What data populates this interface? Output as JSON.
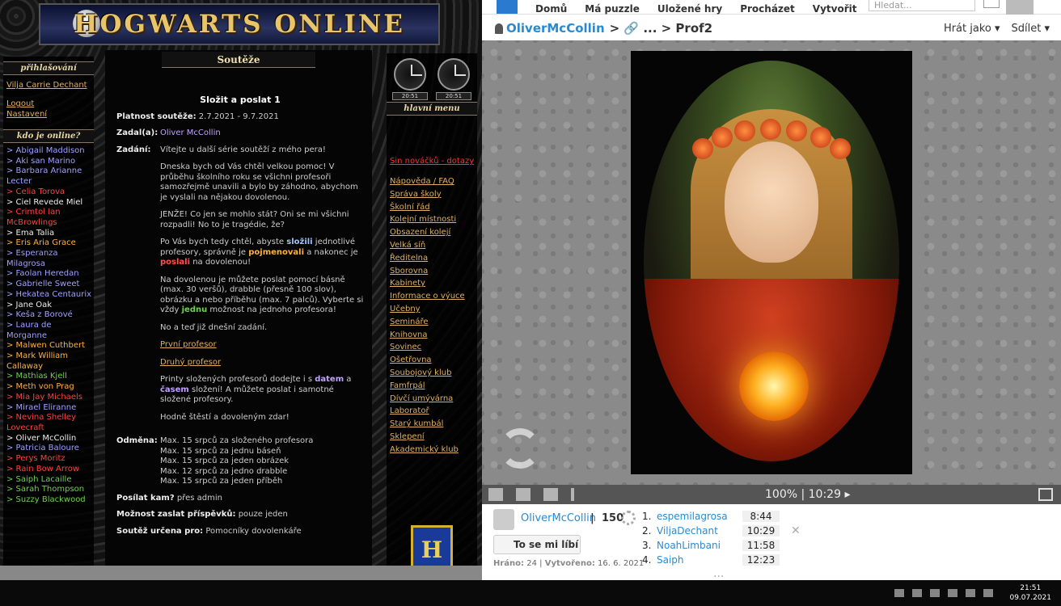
{
  "left": {
    "site_title": "HOGWARTS ONLINE",
    "login_header": "přihlašování",
    "user_link": "Vilja Carrie Dechant",
    "logout": "Logout",
    "settings": "Nastavení",
    "online_header": "kdo je online?",
    "online": [
      {
        "name": "> Abigail Maddison",
        "color": "#a0a0ff"
      },
      {
        "name": "> Aki san Marino",
        "color": "#a0a0ff"
      },
      {
        "name": "> Barbara Arianne Lecter",
        "color": "#a0a0ff"
      },
      {
        "name": "> Celia Torova",
        "color": "#ff4040"
      },
      {
        "name": "> Ciel Revede Miel",
        "color": "#eeeeee"
      },
      {
        "name": "> Crimtol Ian McBrowlings",
        "color": "#ff4040"
      },
      {
        "name": "> Ema Talia",
        "color": "#eeeeee"
      },
      {
        "name": "> Eris Aria Grace",
        "color": "#ffb040"
      },
      {
        "name": "> Esperanza Milagrosa",
        "color": "#a0a0ff"
      },
      {
        "name": "> Faolan Heredan",
        "color": "#a0a0ff"
      },
      {
        "name": "> Gabrielle Sweet",
        "color": "#a0a0ff"
      },
      {
        "name": "> Hekatea Centaurix",
        "color": "#a0a0ff"
      },
      {
        "name": "> Jane Oak",
        "color": "#eeeeee"
      },
      {
        "name": "> Keša z Borové",
        "color": "#a0a0ff"
      },
      {
        "name": "> Laura de Morganne",
        "color": "#a0a0ff"
      },
      {
        "name": "> Malwen Cuthbert",
        "color": "#ffb040"
      },
      {
        "name": "> Mark William Callaway",
        "color": "#ffb040"
      },
      {
        "name": "> Mathias Kjell",
        "color": "#70d050"
      },
      {
        "name": "> Meth von Prag",
        "color": "#ffb040"
      },
      {
        "name": "> Mia Jay Michaels",
        "color": "#ff4040"
      },
      {
        "name": "> Mirael Eliranne",
        "color": "#a0a0ff"
      },
      {
        "name": "> Nevina Shelley Lovecraft",
        "color": "#ff4040"
      },
      {
        "name": "> Oliver McCollin",
        "color": "#eeeeee"
      },
      {
        "name": "> Patricia Baloure",
        "color": "#a0a0ff"
      },
      {
        "name": "> Perys Moritz",
        "color": "#ff4040"
      },
      {
        "name": "> Rain Bow Arrow",
        "color": "#ff4040"
      },
      {
        "name": "> Saiph Lacaille",
        "color": "#70d050"
      },
      {
        "name": "> Sarah Thompson",
        "color": "#70d050"
      },
      {
        "name": "> Suzzy Blackwood",
        "color": "#70d050"
      }
    ],
    "content_header": "Soutěže",
    "contest_title": "Složit a poslat 1",
    "validity_label": "Platnost soutěže:",
    "validity": "2.7.2021 - 9.7.2021",
    "author_label": "Zadal(a):",
    "author": "Oliver McCollin",
    "task_label": "Zadání:",
    "p1": "Vítejte u další série soutěží z mého pera!",
    "p2": "Dneska bych od Vás chtěl velkou pomoc! V průběhu školního roku se všichni profesoři samozřejmě unavili a bylo by záhodno, abychom je vyslali na nějakou dovolenou.",
    "p3": "JENŽE! Co jen se mohlo stát? Oni se mi všichni rozpadli! No to je tragédie, že?",
    "p4a": "Po Vás bych tedy chtěl, abyste ",
    "p4b": "složili",
    "p4c": " jednotlivé profesory, správně je ",
    "p4d": "pojmenovali",
    "p4e": " a nakonec je ",
    "p4f": "poslali",
    "p4g": " na dovolenou!",
    "p5a": "Na dovolenou je můžete poslat pomocí básně (max. 30 veršů), drabble (přesně 100 slov), obrázku a nebo příběhu (max. 7 palců). Vyberte si vždy ",
    "p5b": "jednu",
    "p5c": " možnost na jednoho profesora!",
    "p6": "No a teď již dnešní zadání.",
    "link1": "První profesor",
    "link2": "Druhý profesor",
    "p7a": "Printy složených profesorů dodejte i s ",
    "p7b": "datem",
    "p7c": " a ",
    "p7d": "časem",
    "p7e": " složení! A můžete poslat i samotné složené profesory.",
    "p8": "Hodně štěstí a dovoleným zdar!",
    "reward_label": "Odměna:",
    "rewards": [
      "Max. 15 srpců za složeného profesora",
      "Max. 15 srpců za jednu báseň",
      "Max. 15 srpců za jeden obrázek",
      "Max. 12 srpců za jedno drabble",
      "Max. 15 srpců za jeden příběh"
    ],
    "send_label": "Posílat kam?",
    "send": "přes admin",
    "count_label": "Možnost zaslat příspěvků:",
    "count": "pouze jeden",
    "for_label": "Soutěž určena pro:",
    "for": "Pomocníky dovolenkáře",
    "clock1": "20:51",
    "clock2": "20:51",
    "menu_header": "hlavní menu",
    "menu_red": "Sin nováčků - dotazy",
    "menu": [
      "Nápověda / FAQ",
      "Správa školy",
      "Školní řád",
      "Kolejní místnosti",
      "Obsazení kolejí",
      "Velká síň",
      "Ředitelna",
      "Sborovna",
      "Kabinety",
      "Informace o výuce",
      "Učebny",
      "Semináře",
      "Knihovna",
      "Sovinec",
      "Ošetřovna",
      "Soubojový klub",
      "Famfrpál",
      "Dívčí umývárna",
      "Laboratoř",
      "Starý kumbál",
      "Sklepení",
      "Akademický klub"
    ],
    "crest": "H"
  },
  "right": {
    "nav": [
      "Domů",
      "Má puzzle",
      "Uložené hry",
      "Procházet",
      "Vytvořit"
    ],
    "search_placeholder": "Hledat...",
    "crumb_user": "OliverMcCollin",
    "crumb_rest": "> 🔗 ... > Prof2",
    "play_as": "Hrát jako ▾",
    "share": "Sdílet ▾",
    "status": "100% | 10:29 ▸",
    "user": "OliverMcCollin",
    "score": "150",
    "like": "To se mi líbí",
    "played_label": "Hráno:",
    "played": "24",
    "created_label": "Vytvořeno:",
    "created": "16. 6. 2021",
    "leaderboard": [
      {
        "rank": "1.",
        "name": "espemilagrosa",
        "time": "8:44"
      },
      {
        "rank": "2.",
        "name": "ViljaDechant",
        "time": "10:29"
      },
      {
        "rank": "3.",
        "name": "NoahLimbani",
        "time": "11:58"
      },
      {
        "rank": "4.",
        "name": "Saiph",
        "time": "12:23"
      }
    ],
    "more": "...",
    "close": "✕"
  },
  "taskbar": {
    "time": "21:51",
    "date": "09.07.2021"
  }
}
